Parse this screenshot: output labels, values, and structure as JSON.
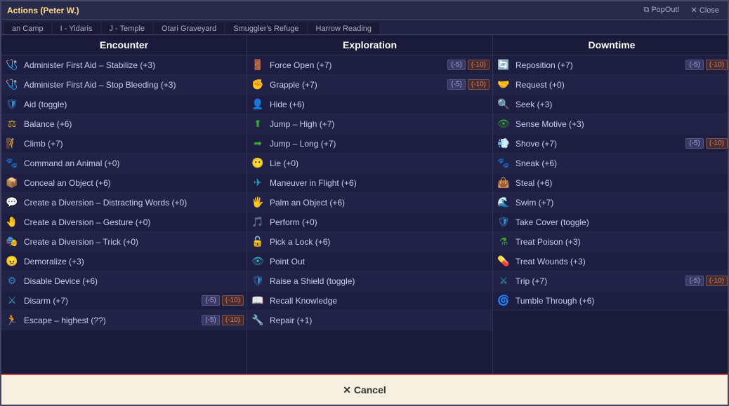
{
  "window": {
    "title": "Actions (Peter W.)",
    "popout_label": "⧉ PopOut!",
    "close_label": "✕ Close"
  },
  "tabs": [
    {
      "label": "an Camp",
      "active": false
    },
    {
      "label": "I - Yidaris",
      "active": false
    },
    {
      "label": "J - Temple",
      "active": false
    },
    {
      "label": "Otari Graveyard",
      "active": false
    },
    {
      "label": "Smuggler's Refuge",
      "active": false
    },
    {
      "label": "Harrow Reading",
      "active": false
    }
  ],
  "columns": [
    {
      "header": "Encounter",
      "actions": [
        {
          "icon": "🩺",
          "icon_color": "icon-red",
          "label": "Administer First Aid – Stabilize (+3)",
          "badges": []
        },
        {
          "icon": "🩺",
          "icon_color": "icon-red",
          "label": "Administer First Aid – Stop Bleeding (+3)",
          "badges": []
        },
        {
          "icon": "🛡",
          "icon_color": "icon-blue",
          "label": "Aid (toggle)",
          "badges": []
        },
        {
          "icon": "⚖",
          "icon_color": "icon-yellow",
          "label": "Balance (+6)",
          "badges": []
        },
        {
          "icon": "🧗",
          "icon_color": "icon-orange",
          "label": "Climb (+7)",
          "badges": []
        },
        {
          "icon": "🐾",
          "icon_color": "icon-green",
          "label": "Command an Animal (+0)",
          "badges": []
        },
        {
          "icon": "📦",
          "icon_color": "icon-blue",
          "label": "Conceal an Object (+6)",
          "badges": []
        },
        {
          "icon": "💬",
          "icon_color": "icon-purple",
          "label": "Create a Diversion – Distracting Words (+0)",
          "badges": []
        },
        {
          "icon": "🤚",
          "icon_color": "icon-purple",
          "label": "Create a Diversion – Gesture (+0)",
          "badges": []
        },
        {
          "icon": "🎭",
          "icon_color": "icon-purple",
          "label": "Create a Diversion – Trick (+0)",
          "badges": []
        },
        {
          "icon": "😠",
          "icon_color": "icon-orange",
          "label": "Demoralize (+3)",
          "badges": []
        },
        {
          "icon": "⚙",
          "icon_color": "icon-blue",
          "label": "Disable Device (+6)",
          "badges": []
        },
        {
          "icon": "⚔",
          "icon_color": "icon-cyan",
          "label": "Disarm (+7)",
          "badges": [
            {
              "label": "(-5)",
              "neg": false
            },
            {
              "label": "(-10)",
              "neg": true
            }
          ]
        },
        {
          "icon": "🏃",
          "icon_color": "icon-green",
          "label": "Escape – highest (??)",
          "badges": [
            {
              "label": "(-5)",
              "neg": false
            },
            {
              "label": "(-10)",
              "neg": true
            }
          ]
        }
      ]
    },
    {
      "header": "Exploration",
      "actions": [
        {
          "icon": "🚪",
          "icon_color": "icon-orange",
          "label": "Force Open (+7)",
          "badges": [
            {
              "label": "(-5)",
              "neg": false
            },
            {
              "label": "(-10)",
              "neg": true
            }
          ]
        },
        {
          "icon": "✊",
          "icon_color": "icon-orange",
          "label": "Grapple (+7)",
          "badges": [
            {
              "label": "(-5)",
              "neg": false
            },
            {
              "label": "(-10)",
              "neg": true
            }
          ]
        },
        {
          "icon": "👤",
          "icon_color": "icon-blue",
          "label": "Hide (+6)",
          "badges": []
        },
        {
          "icon": "⬆",
          "icon_color": "icon-green",
          "label": "Jump – High (+7)",
          "badges": []
        },
        {
          "icon": "➡",
          "icon_color": "icon-green",
          "label": "Jump – Long (+7)",
          "badges": []
        },
        {
          "icon": "😶",
          "icon_color": "icon-purple",
          "label": "Lie (+0)",
          "badges": []
        },
        {
          "icon": "✈",
          "icon_color": "icon-cyan",
          "label": "Maneuver in Flight (+6)",
          "badges": []
        },
        {
          "icon": "🖐",
          "icon_color": "icon-orange",
          "label": "Palm an Object (+6)",
          "badges": []
        },
        {
          "icon": "🎵",
          "icon_color": "icon-yellow",
          "label": "Perform (+0)",
          "badges": []
        },
        {
          "icon": "🔓",
          "icon_color": "icon-blue",
          "label": "Pick a Lock (+6)",
          "badges": []
        },
        {
          "icon": "👁",
          "icon_color": "icon-cyan",
          "label": "Point Out",
          "badges": []
        },
        {
          "icon": "🛡",
          "icon_color": "icon-blue",
          "label": "Raise a Shield (toggle)",
          "badges": []
        },
        {
          "icon": "📖",
          "icon_color": "icon-purple",
          "label": "Recall Knowledge",
          "badges": []
        },
        {
          "icon": "🔧",
          "icon_color": "icon-blue",
          "label": "Repair (+1)",
          "badges": []
        }
      ]
    },
    {
      "header": "Downtime",
      "actions": [
        {
          "icon": "🔄",
          "icon_color": "icon-blue",
          "label": "Reposition (+7)",
          "badges": [
            {
              "label": "(-5)",
              "neg": false
            },
            {
              "label": "(-10)",
              "neg": true
            }
          ]
        },
        {
          "icon": "🤝",
          "icon_color": "icon-blue",
          "label": "Request (+0)",
          "badges": []
        },
        {
          "icon": "🔍",
          "icon_color": "icon-cyan",
          "label": "Seek (+3)",
          "badges": []
        },
        {
          "icon": "👁",
          "icon_color": "icon-green",
          "label": "Sense Motive (+3)",
          "badges": []
        },
        {
          "icon": "💨",
          "icon_color": "icon-cyan",
          "label": "Shove (+7)",
          "badges": [
            {
              "label": "(-5)",
              "neg": false
            },
            {
              "label": "(-10)",
              "neg": true
            }
          ]
        },
        {
          "icon": "🐾",
          "icon_color": "icon-blue",
          "label": "Sneak (+6)",
          "badges": []
        },
        {
          "icon": "👜",
          "icon_color": "icon-orange",
          "label": "Steal (+6)",
          "badges": []
        },
        {
          "icon": "🌊",
          "icon_color": "icon-cyan",
          "label": "Swim (+7)",
          "badges": []
        },
        {
          "icon": "🛡",
          "icon_color": "icon-blue",
          "label": "Take Cover (toggle)",
          "badges": []
        },
        {
          "icon": "⚗",
          "icon_color": "icon-green",
          "label": "Treat Poison (+3)",
          "badges": []
        },
        {
          "icon": "💊",
          "icon_color": "icon-red",
          "label": "Treat Wounds (+3)",
          "badges": []
        },
        {
          "icon": "⚔",
          "icon_color": "icon-cyan",
          "label": "Trip (+7)",
          "badges": [
            {
              "label": "(-5)",
              "neg": false
            },
            {
              "label": "(-10)",
              "neg": true
            }
          ]
        },
        {
          "icon": "🌀",
          "icon_color": "icon-yellow",
          "label": "Tumble Through (+6)",
          "badges": []
        }
      ]
    }
  ],
  "cancel": {
    "label": "✕ Cancel"
  }
}
